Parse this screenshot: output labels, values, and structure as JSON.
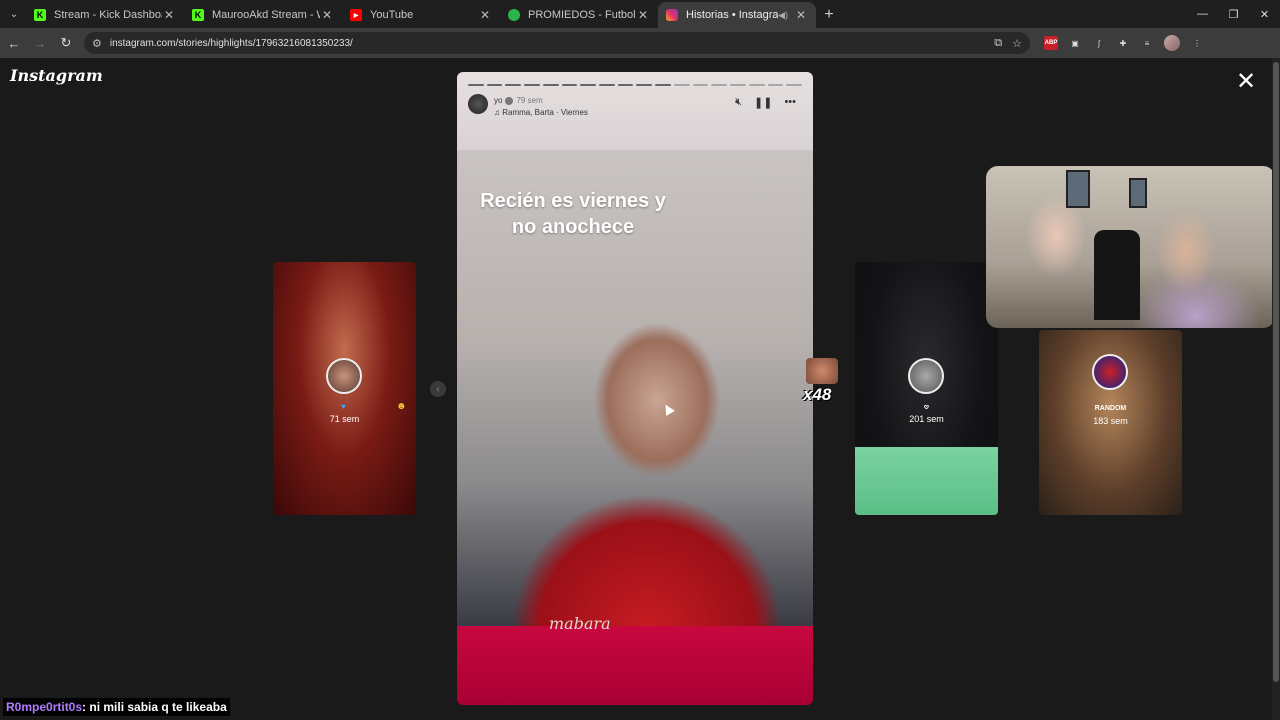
{
  "browser": {
    "tabs": [
      {
        "title": "Stream - Kick Dashboard",
        "favicon": "kick-icon",
        "color": "#53fc18",
        "active": false
      },
      {
        "title": "MaurooAkd Stream - Watch Live",
        "favicon": "kick-icon",
        "color": "#53fc18",
        "active": false
      },
      {
        "title": "YouTube",
        "favicon": "youtube-icon",
        "color": "#ff0000",
        "active": false
      },
      {
        "title": "PROMIEDOS - Futbol Argentino",
        "favicon": "promiedos-icon",
        "color": "#2bb44a",
        "active": false
      },
      {
        "title": "Historias • Instagram",
        "favicon": "instagram-icon",
        "color": "#e1306c",
        "active": true
      }
    ],
    "url": "instagram.com/stories/highlights/17963216081350233/"
  },
  "instagram": {
    "logo": "Instagram",
    "story": {
      "username": "yo",
      "time": "79 sem",
      "music": "Ramma, Barta · Viernes",
      "caption_line1": "Recién es viernes y",
      "caption_line2": "no anochece",
      "shirt_text": "mabara",
      "progress_total": 18,
      "progress_done": 11
    },
    "previews": [
      {
        "id": "left",
        "name": "",
        "time": "71 sem"
      },
      {
        "id": "cat",
        "name": "𖹭",
        "time": "201 sem"
      },
      {
        "id": "random",
        "name": "RANDOM",
        "time": "183 sem"
      }
    ]
  },
  "stream_overlay": {
    "emote_text": "x48",
    "chat_user": "R0mpe0rtit0s",
    "chat_message": ": ni mili sabia q te likeaba"
  }
}
